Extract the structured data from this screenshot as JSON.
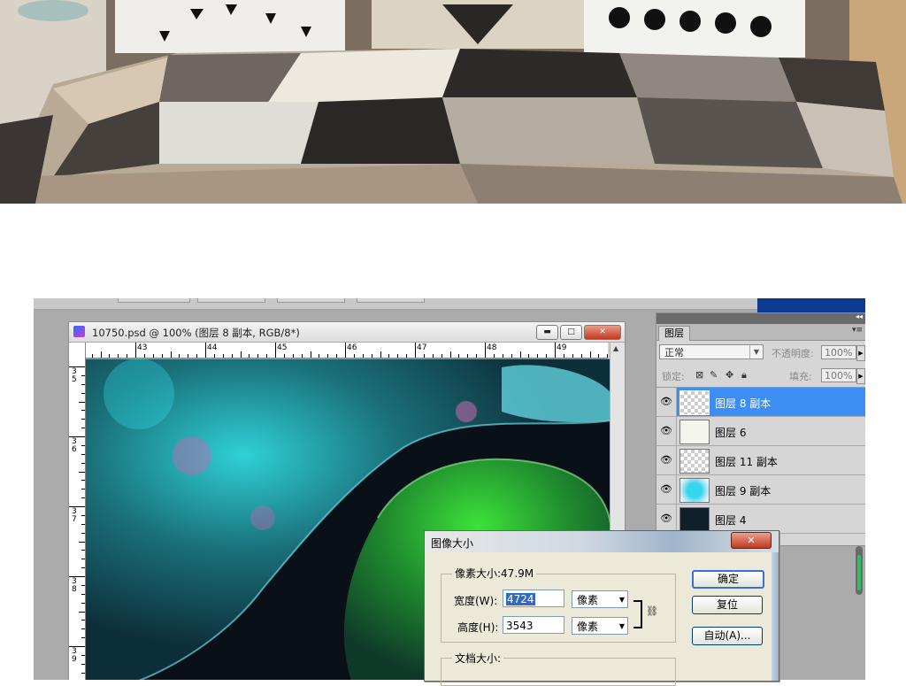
{
  "document_window": {
    "title": "10750.psd @ 100% (图层 8 副本, RGB/8*)",
    "ruler_h": [
      "43",
      "44",
      "45",
      "46",
      "47",
      "48",
      "49"
    ],
    "ruler_v": [
      "3\n5",
      "3\n6",
      "3\n7",
      "3\n8",
      "3\n9"
    ]
  },
  "layers_panel": {
    "tab": "图层",
    "blend_mode": "正常",
    "opacity_label": "不透明度:",
    "opacity_value": "100%",
    "lock_label": "锁定:",
    "fill_label": "填充:",
    "fill_value": "100%",
    "layers": [
      {
        "name": "图层 8 副本",
        "selected": true
      },
      {
        "name": "图层 6",
        "selected": false
      },
      {
        "name": "图层 11 副本",
        "selected": false
      },
      {
        "name": "图层 9 副本",
        "selected": false
      },
      {
        "name": "图层 4",
        "selected": false
      }
    ]
  },
  "image_size_dialog": {
    "title": "图像大小",
    "pixel_dimensions_label": "像素大小:47.9M",
    "width_label": "宽度(W):",
    "width_value": "4724",
    "width_unit": "像素",
    "height_label": "高度(H):",
    "height_value": "3543",
    "height_unit": "像素",
    "ok_button": "确定",
    "reset_button": "复位",
    "auto_button": "自动(A)...",
    "document_size_label": "文档大小:"
  },
  "colors": {
    "selection_blue": "#3d8ef2",
    "dialog_bg": "#ece9d8",
    "panel_bg": "#d6d6d6",
    "workspace_bg": "#ababab"
  }
}
